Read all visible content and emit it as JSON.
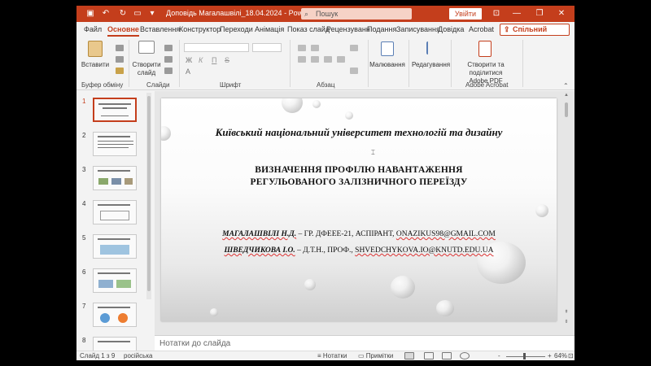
{
  "app": {
    "doc_title": "Доповідь Магалашвілі_18.04.2024",
    "app_name": "PowerPoint",
    "title_separator": "-",
    "search_placeholder": "Пошук",
    "signin_label": "Увійти",
    "accent_color": "#c43e1c"
  },
  "tabs": [
    {
      "label": "Файл"
    },
    {
      "label": "Основне",
      "active": true
    },
    {
      "label": "Вставлення"
    },
    {
      "label": "Конструктор"
    },
    {
      "label": "Переходи"
    },
    {
      "label": "Анімація"
    },
    {
      "label": "Показ слайд"
    },
    {
      "label": "Рецензуванн"
    },
    {
      "label": "Подання"
    },
    {
      "label": "Записування"
    },
    {
      "label": "Довідка"
    },
    {
      "label": "Acrobat"
    }
  ],
  "share_label": "Спільний доступ",
  "ribbon": {
    "paste_label": "Вставити",
    "new_slide_label_1": "Створити",
    "new_slide_label_2": "слайд",
    "drawing_label": "Малювання",
    "editing_label": "Редагування",
    "acrobat_label_1": "Створити та поділитися",
    "acrobat_label_2": "Adobe PDF",
    "groups": {
      "clipboard": "Буфер обміну",
      "slides": "Слайди",
      "font": "Шрифт",
      "paragraph": "Абзац",
      "acrobat": "Adobe Acrobat"
    },
    "format_marks": {
      "bold": "Ж",
      "italic": "К",
      "underline": "П",
      "strike": "S",
      "font_color": "A"
    }
  },
  "thumbnails": [
    {
      "number": "1",
      "selected": true
    },
    {
      "number": "2"
    },
    {
      "number": "3"
    },
    {
      "number": "4"
    },
    {
      "number": "5"
    },
    {
      "number": "6"
    },
    {
      "number": "7"
    },
    {
      "number": "8"
    }
  ],
  "slide": {
    "university": "Київський національний університет технологій та дизайну",
    "title_line_1": "ВИЗНАЧЕННЯ ПРОФІЛЮ НАВАНТАЖЕННЯ",
    "title_line_2": "РЕГУЛЬОВАНОГО ЗАЛІЗНИЧНОГО ПЕРЕЇЗДУ",
    "author_1_name": "МАГАЛАШВІЛІ Н.Д.",
    "author_1_info": "– ГР. ДФЕЕЕ-21, АСПІРАНТ, ",
    "author_1_email": "ONAZIKUS98@GMAIL.COM",
    "author_2_name": "ШВЕДЧИКОВА І.О.",
    "author_2_info": "– Д.Т.Н., ПРОФ., ",
    "author_2_email": "SHVEDCHYKOVA.IO@KNUTD.EDU.UA"
  },
  "notes_placeholder": "Нотатки до слайда",
  "status": {
    "slide_info": "Слайд 1 з 9",
    "language": "російська",
    "notes_label": "Нотатки",
    "comments_label": "Примітки",
    "zoom": "64%",
    "zoom_minus": "-",
    "zoom_plus": "+"
  },
  "icons": [
    "save-icon",
    "undo-icon",
    "redo-icon",
    "present-icon",
    "search-icon",
    "share-icon",
    "paste-icon",
    "new-slide-icon",
    "drawing-icon",
    "editing-icon",
    "adobe-pdf-icon"
  ]
}
